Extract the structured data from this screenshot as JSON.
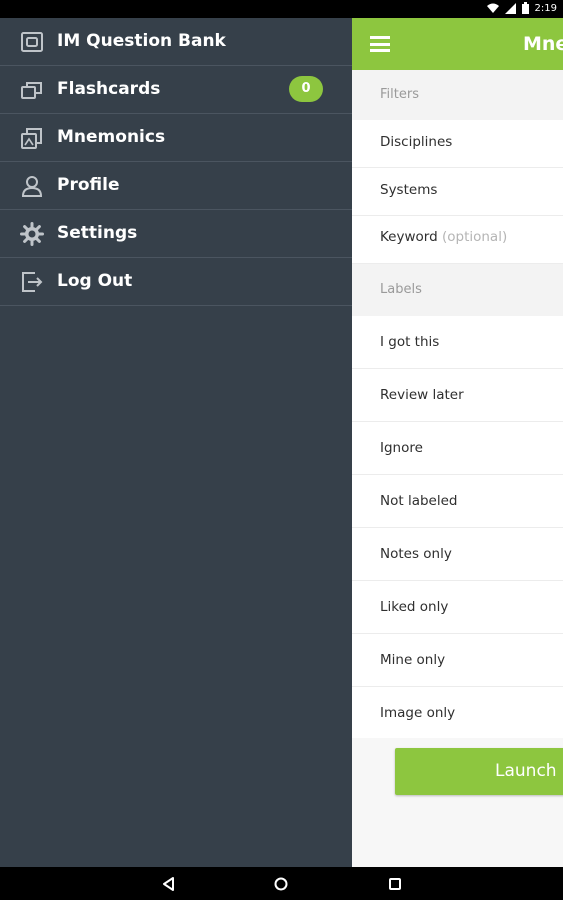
{
  "status": {
    "time": "2:19"
  },
  "drawer": {
    "items": [
      {
        "label": "IM Question Bank",
        "icon": "question-bank-icon"
      },
      {
        "label": "Flashcards",
        "icon": "flashcards-icon",
        "badge": "0"
      },
      {
        "label": "Mnemonics",
        "icon": "mnemonics-icon"
      },
      {
        "label": "Profile",
        "icon": "profile-icon"
      },
      {
        "label": "Settings",
        "icon": "gear-icon"
      },
      {
        "label": "Log Out",
        "icon": "logout-icon"
      }
    ]
  },
  "appbar": {
    "title": "Mnemonics"
  },
  "filters": {
    "header": "Filters",
    "disciplines": "Disciplines",
    "systems": "Systems",
    "keyword": "Keyword",
    "keyword_hint": "(optional)"
  },
  "labels": {
    "header": "Labels",
    "items": [
      "I got this",
      "Review later",
      "Ignore",
      "Not labeled",
      "Notes only",
      "Liked only",
      "Mine only",
      "Image only"
    ]
  },
  "launch_label": "Launch",
  "colors": {
    "accent": "#8dc63f",
    "drawer_bg": "#36404a"
  }
}
